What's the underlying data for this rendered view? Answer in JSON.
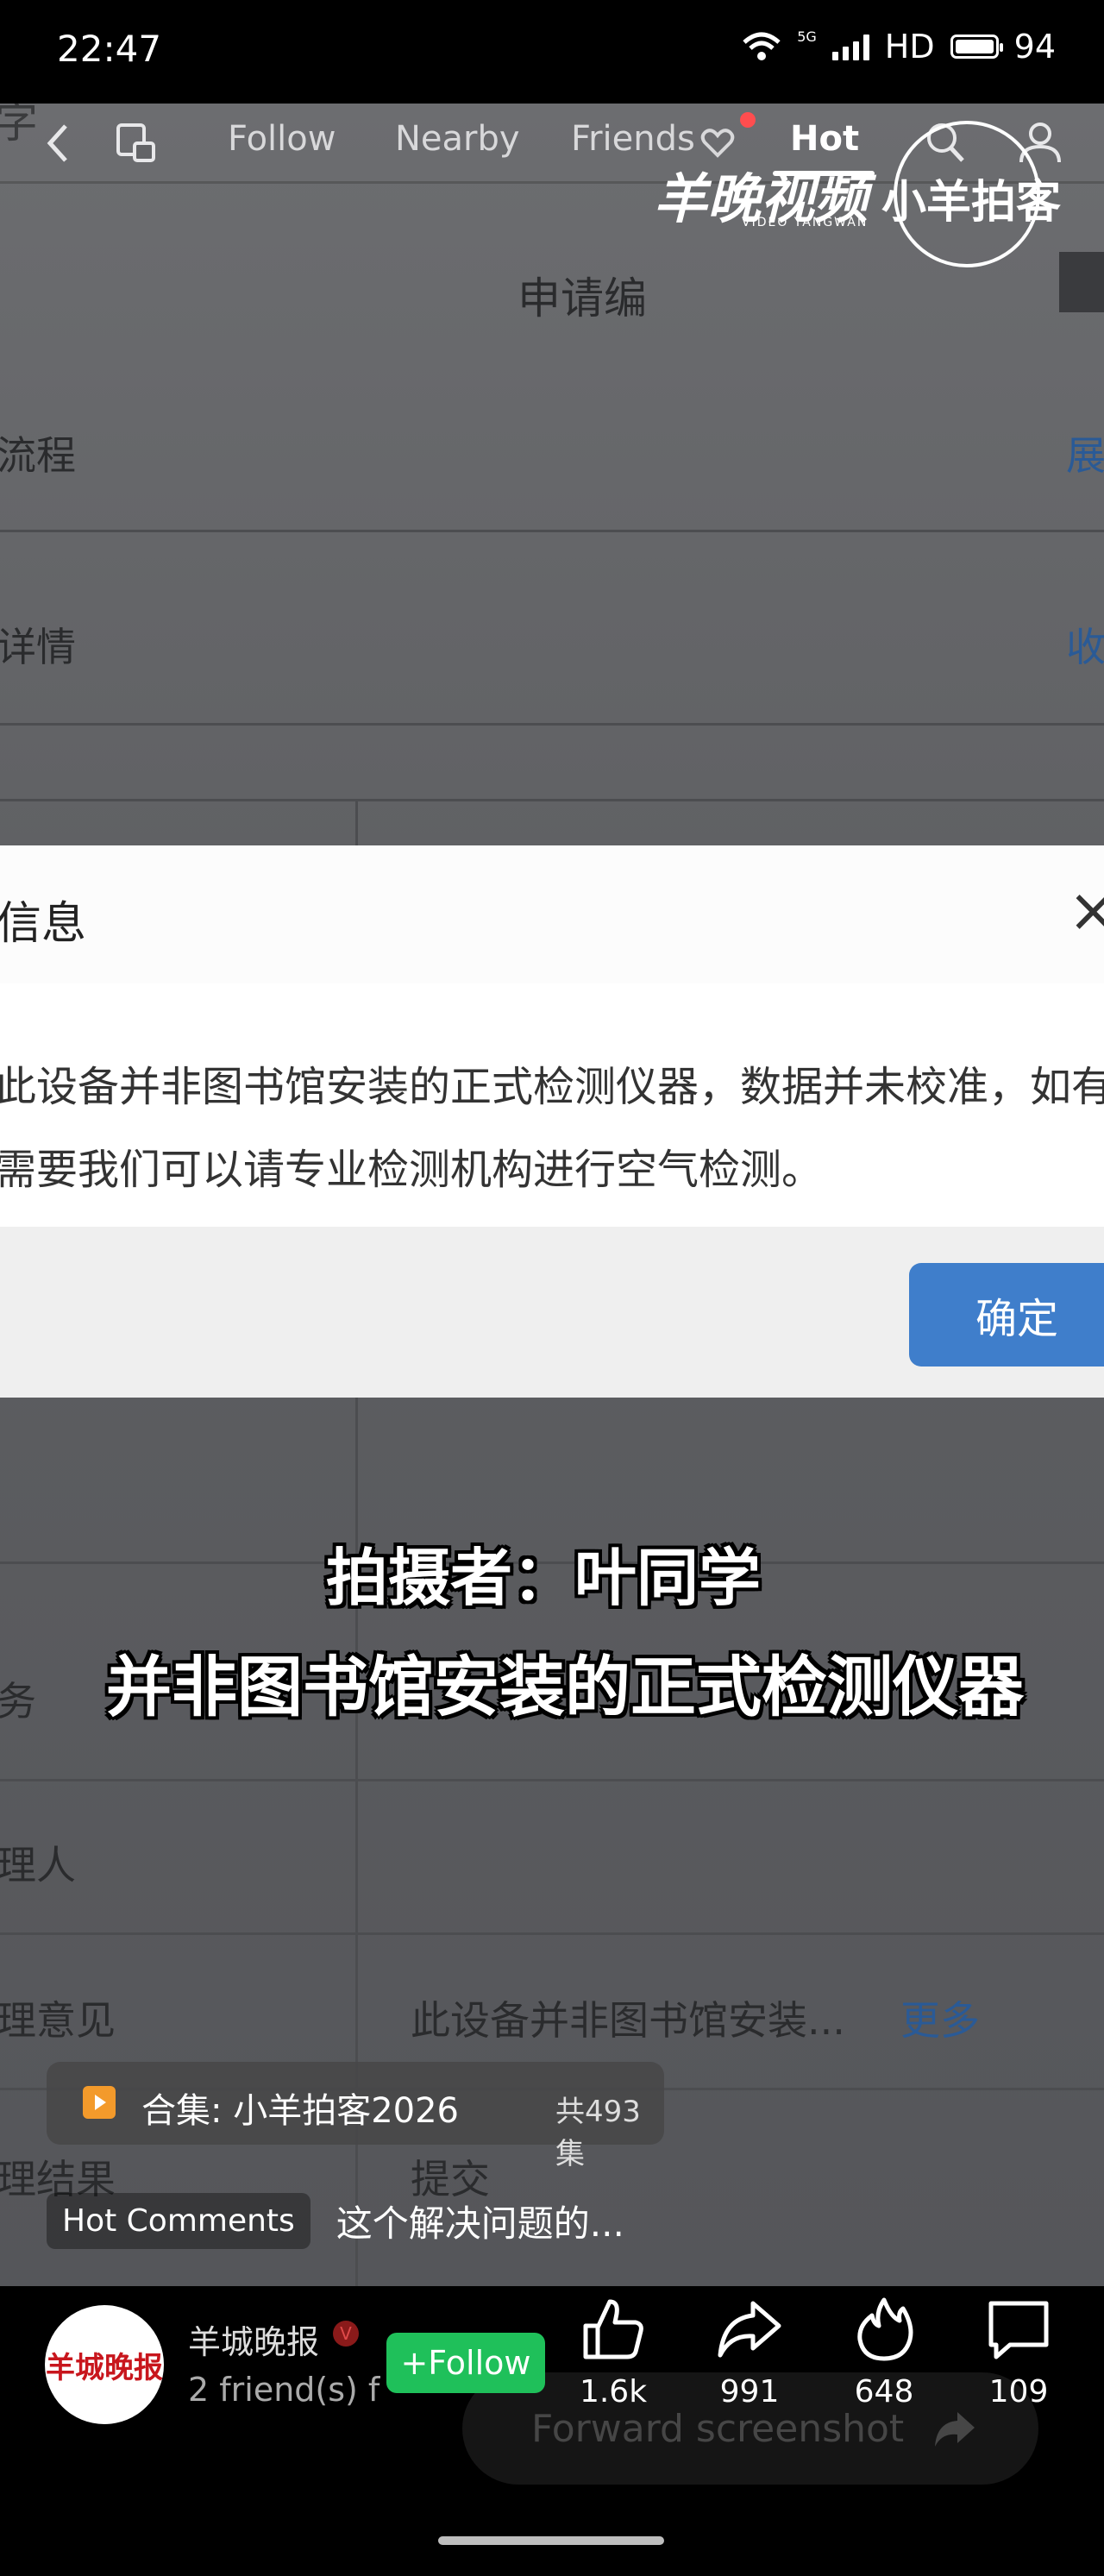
{
  "status_bar": {
    "time": "22:47",
    "network": "5G",
    "hd": "HD",
    "battery": "94"
  },
  "top_nav": {
    "tabs": [
      "Follow",
      "Nearby",
      "Friends",
      "Hot"
    ],
    "active_tab": "Hot"
  },
  "watermark": {
    "logo_main": "羊晚视频",
    "logo_sub": "VIDEO YANGWAN",
    "logo_secondary": "小羊拍客"
  },
  "background_ui": {
    "top_partial": "字",
    "apply_text": "申请编",
    "rows": [
      {
        "left": "流程",
        "right": "展"
      },
      {
        "left": "详情",
        "right": "收"
      }
    ],
    "lower_rows": [
      {
        "left": "务",
        "right": ""
      },
      {
        "left": "理人",
        "right": ""
      },
      {
        "left": "理意见",
        "value": "此设备并非图书馆安装...",
        "more": "更多"
      },
      {
        "left": "理结果",
        "value": "提交"
      }
    ]
  },
  "dialog": {
    "title": "信息",
    "close": "×",
    "message": "此设备并非图书馆安装的正式检测仪器，数据并未校准，如有需要我们可以请专业检测机构进行空气检测。",
    "confirm": "确定"
  },
  "subtitles": {
    "line1": "拍摄者：叶同学",
    "line2": "并非图书馆安装的正式检测仪器"
  },
  "collection": {
    "label": "合集: 小羊拍客2026",
    "count": "共493集"
  },
  "hot_comments": {
    "tag": "Hot Comments",
    "text": "这个解决问题的..."
  },
  "author": {
    "name": "羊城晚报",
    "friends": "2 friend(s) f",
    "avatar_text": "羊城晚报",
    "follow": "+Follow"
  },
  "actions": {
    "like": "1.6k",
    "share": "991",
    "fire": "648",
    "comment": "109"
  },
  "forward_hint": "Forward screenshot"
}
